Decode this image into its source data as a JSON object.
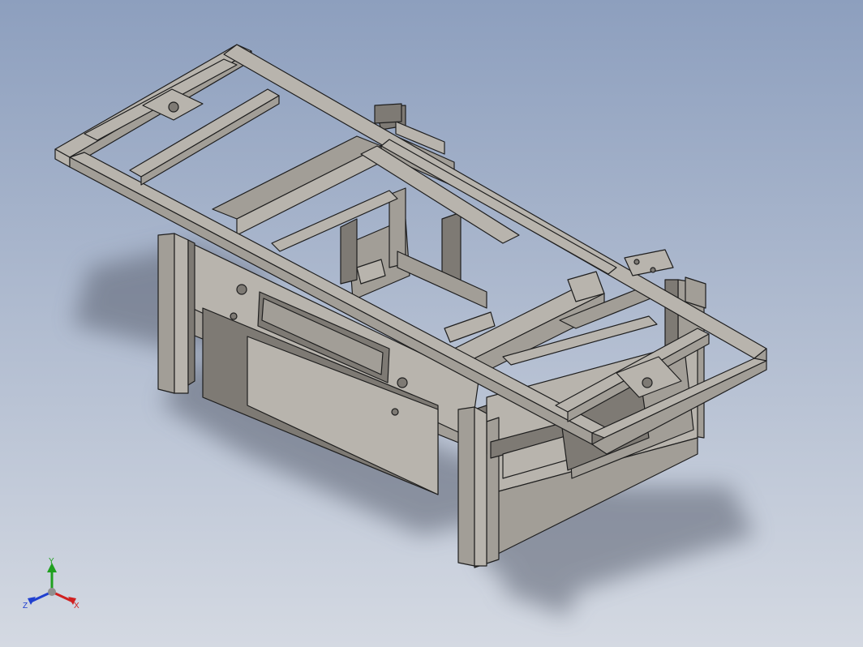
{
  "viewport": {
    "background_top": "#8d9fbe",
    "background_bottom": "#d4d9e2",
    "shadow_color": "#5a6070"
  },
  "model": {
    "surface_light": "#b8b4ad",
    "surface_mid": "#a29e97",
    "surface_dark": "#7e7a74",
    "edge_color": "#1e1e1e"
  },
  "triad": {
    "x_label": "X",
    "y_label": "Y",
    "z_label": "Z",
    "x_color": "#d02020",
    "y_color": "#20a020",
    "z_color": "#2040d0"
  }
}
